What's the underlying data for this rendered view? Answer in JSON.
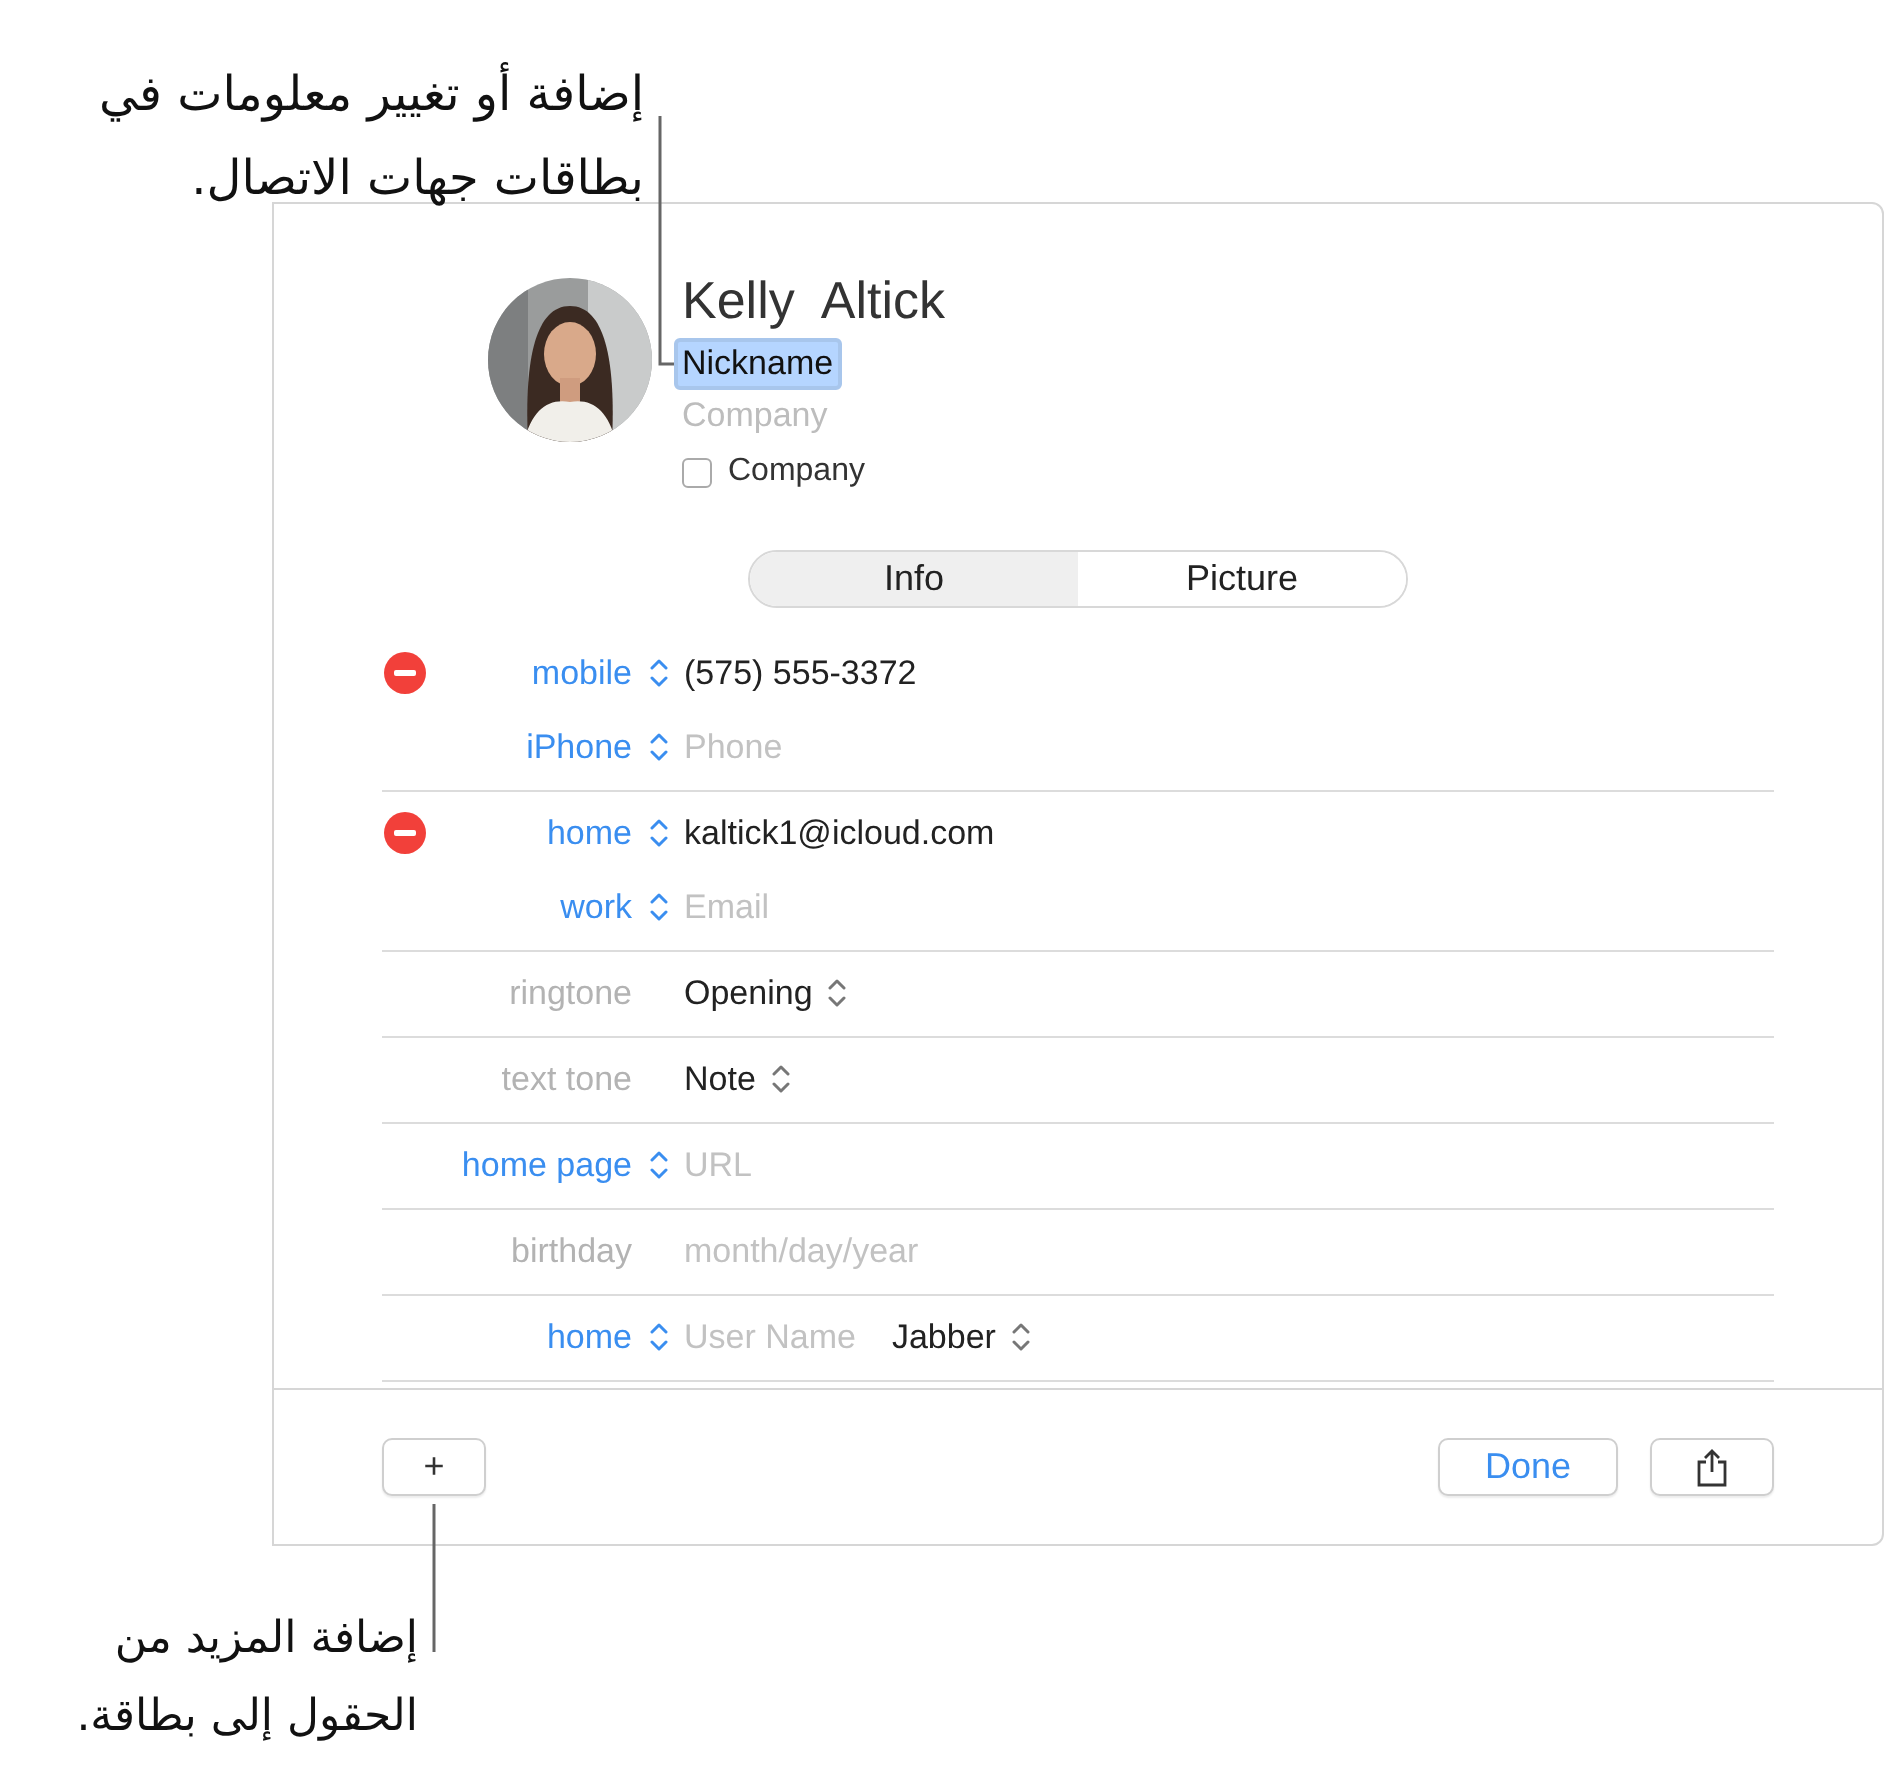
{
  "top_callout": {
    "lines": [
      "إضافة أو تغيير معلومات في",
      "بطاقات جهات الاتصال."
    ]
  },
  "bottom_callout": {
    "lines": [
      "إضافة المزيد من",
      "الحقول إلى بطاقة."
    ]
  },
  "contact": {
    "first_name": "Kelly",
    "last_name": "Altick",
    "nickname": {
      "value": "Nickname",
      "selected": true
    },
    "company": {
      "placeholder": "Company"
    },
    "company_checkbox": {
      "label": "Company",
      "checked": false
    }
  },
  "tabs": [
    {
      "label": "Info",
      "selected": true
    },
    {
      "label": "Picture",
      "selected": false
    }
  ],
  "groups": [
    {
      "rows": [
        {
          "label": "mobile",
          "label_popup": true,
          "removable": true,
          "value": "(575) 555-3372"
        },
        {
          "label": "iPhone",
          "label_popup": true,
          "removable": false,
          "placeholder": "Phone"
        }
      ]
    },
    {
      "rows": [
        {
          "label": "home",
          "label_popup": true,
          "removable": true,
          "value": "kaltick1@icloud.com"
        },
        {
          "label": "work",
          "label_popup": true,
          "removable": false,
          "placeholder": "Email"
        }
      ]
    },
    {
      "rows": [
        {
          "label": "ringtone",
          "label_popup": false,
          "removable": false,
          "value": "Opening",
          "value_popup": true
        }
      ]
    },
    {
      "rows": [
        {
          "label": "text tone",
          "label_popup": false,
          "removable": false,
          "value": "Note",
          "value_popup": true
        }
      ]
    },
    {
      "rows": [
        {
          "label": "home page",
          "label_popup": true,
          "removable": false,
          "placeholder": "URL"
        }
      ]
    },
    {
      "rows": [
        {
          "label": "birthday",
          "label_popup": false,
          "removable": false,
          "placeholder": "month/day/year"
        }
      ]
    },
    {
      "rows": [
        {
          "label": "home",
          "label_popup": true,
          "removable": false,
          "placeholder": "User Name",
          "service": "Jabber"
        }
      ]
    }
  ],
  "footer": {
    "add_button": "+",
    "done_button": "Done"
  }
}
